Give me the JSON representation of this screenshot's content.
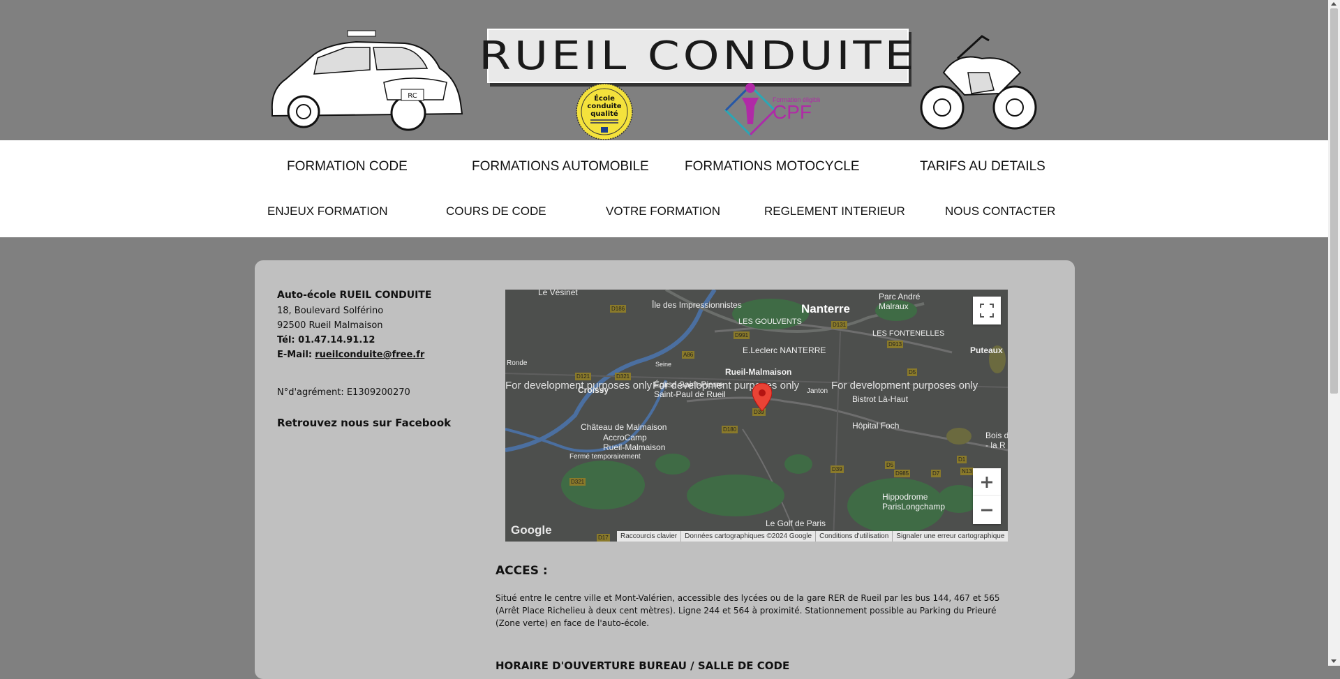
{
  "header": {
    "title": "RUEIL CONDUITE",
    "car_plate": "RC",
    "badge": {
      "line1": "École",
      "line2": "conduite",
      "line3": "qualité"
    },
    "cpf": {
      "small": "Formation éligible au",
      "big": "CPF"
    }
  },
  "nav": {
    "top": [
      "FORMATION CODE",
      "FORMATIONS AUTOMOBILE",
      "FORMATIONS MOTOCYCLE",
      "TARIFS AU DETAILS"
    ],
    "bottom": [
      "ENJEUX FORMATION",
      "COURS DE CODE",
      "VOTRE FORMATION",
      "REGLEMENT INTERIEUR",
      "NOUS CONTACTER"
    ]
  },
  "contact": {
    "name": "Auto-école RUEIL CONDUITE",
    "address1": "18, Boulevard Solférino",
    "address2": "92500 Rueil Malmaison",
    "tel_label": "Tél:",
    "tel": "01.47.14.91.12",
    "email_label": "E-Mail:",
    "email": "rueilconduite@free.fr",
    "agrement": "N°d'agrément: E1309200270",
    "facebook": "Retrouvez nous sur Facebook"
  },
  "map": {
    "places": {
      "vesinet": "Le Vésinet",
      "impressionnistes": "Île des Impressionnistes",
      "nanterre": "Nanterre",
      "malraux": "Parc André\nMalraux",
      "goulvents": "LES GOULVENTS",
      "fontenelles": "LES FONTENELLES",
      "leclerc": "E.Leclerc NANTERRE",
      "puteaux": "Puteaux",
      "rueil": "Rueil-Malmaison",
      "croissy": "Croissy",
      "saintpaul": "Église Saint-Pierre\nSaint-Paul de Rueil",
      "bistrot": "Bistrot Là-Haut",
      "malmaison": "Château de Malmaison",
      "accrocamp": "AccroCamp\nRueil-Malmaison",
      "ferme": "Fermé temporairement",
      "foch": "Hôpital Foch",
      "hippodrome": "Hippodrome\nParisLongchamp",
      "golf": "Le Golf de Paris",
      "bois": "Bois de\n- la R",
      "seine": "Seine",
      "janton": "Janton",
      "ronde": "Ronde"
    },
    "dev_text": "For development purposes only",
    "roads": [
      "D186",
      "D131",
      "D991",
      "D913",
      "A86",
      "D121",
      "D321",
      "D5",
      "D39",
      "D180",
      "D321",
      "D39",
      "D5",
      "D985",
      "D7",
      "N13",
      "D1",
      "D17"
    ],
    "footer": [
      "Raccourcis clavier",
      "Données cartographiques ©2024 Google",
      "Conditions d'utilisation",
      "Signaler une erreur cartographique"
    ],
    "google": "Google"
  },
  "acces": {
    "title": "ACCES :",
    "text": "Situé entre le centre ville et Mont-Valérien, accessible des lycées ou de la gare RER de Rueil par les bus 144, 467 et 565 (Arrêt Place Richelieu à deux cent mètres). Ligne 244 et 564 à proximité. Stationnement possible au Parking du Prieuré (Zone verte) en face de l'auto-école."
  },
  "horaire": "HORAIRE D'OUVERTURE BUREAU / SALLE DE CODE",
  "colors": {
    "page_bg": "#808080",
    "card_bg": "#c0c0c0",
    "nav_bg": "#ffffff",
    "marker": "#ea4335",
    "badge": "#f4e23c",
    "cpf_purple": "#b02aa6"
  }
}
